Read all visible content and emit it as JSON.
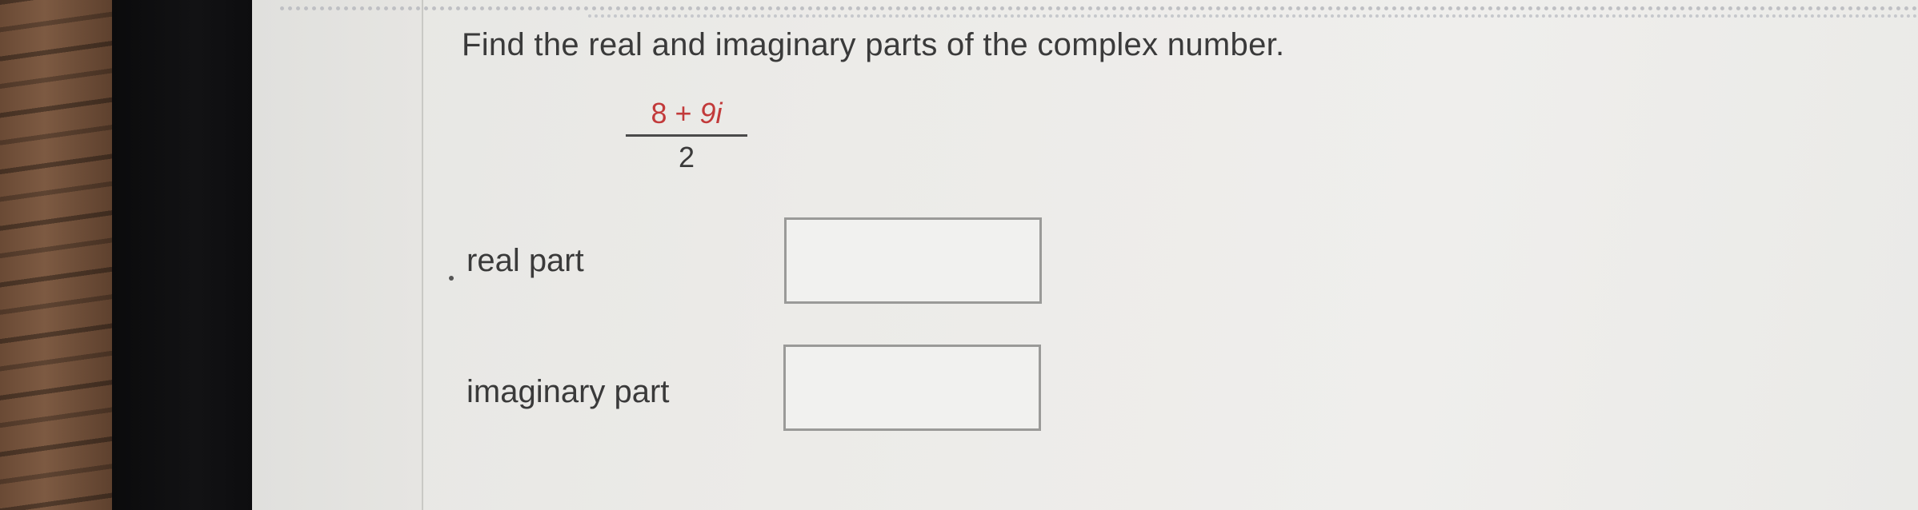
{
  "question": {
    "text": "Find the real and imaginary parts of the complex number."
  },
  "expression": {
    "numerator_real": "8",
    "numerator_operator": "+",
    "numerator_imag": "9i",
    "denominator": "2"
  },
  "fields": {
    "real_part": {
      "label": "real part",
      "value": ""
    },
    "imaginary_part": {
      "label": "imaginary part",
      "value": ""
    }
  },
  "colors": {
    "numerator_text": "#c23a3a",
    "body_text": "#3a3a3a",
    "input_border": "#9a9a98"
  }
}
